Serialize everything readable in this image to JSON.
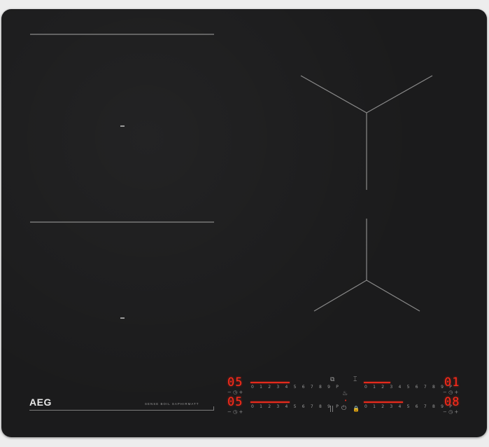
{
  "brand": "AEG",
  "model_line": "SENSE BOIL SAPHIRMATT",
  "zones": [
    {
      "id": "front-left-upper",
      "power": "05",
      "scale": "0 1 2 3 4 5 6 7 8 9 P",
      "timer": "− ◷ +"
    },
    {
      "id": "front-left-lower",
      "power": "05",
      "scale": "0 1 2 3 4 5 6 7 8 9 P",
      "timer": "− ◷ +"
    },
    {
      "id": "right-upper",
      "power": "01",
      "scale": "0 1 2 3 4 5 6 7 8 9 P",
      "timer": "− ◷ +"
    },
    {
      "id": "right-lower",
      "power": "08",
      "scale": "0 1 2 3 4 5 6 7 8 9 P",
      "timer": "− ◷ +"
    }
  ],
  "icons": {
    "bridge": "⧉",
    "hob2hood": "⌶",
    "pan": "♨",
    "pause": "||",
    "power": "⏻",
    "lock": "🔒"
  },
  "colors": {
    "glass": "#1b1b1c",
    "display_red": "#ff2a1a",
    "lines": "#8a8a8a"
  }
}
